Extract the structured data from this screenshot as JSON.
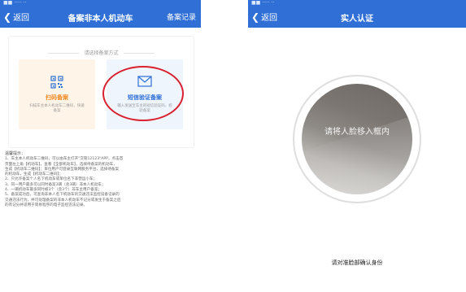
{
  "left": {
    "status": "■■ ····· ··",
    "back_label": "返回",
    "title": "备案非本人机动车",
    "right_action": "备案记录",
    "card_title": "请选择备案方式",
    "option_scan": {
      "label": "扫码备案",
      "desc": "扫描车主本人机动车二维码，快速备案",
      "icon": "qr-code-icon",
      "color": "#f08a24"
    },
    "option_sms": {
      "label": "短信验证备案",
      "desc": "输入发送至车主的短信验证码，校验备案",
      "icon": "envelope-icon",
      "color": "#2f6fd6"
    },
    "notes_title": "温馨提示：",
    "notes": [
      "1、车主本人机动车二维码，可以由车主打开\"交管12123\"APP，点击首",
      "页面左上角【机动车】，查看【全部机动车】，选择待备案的机动车，",
      "生成【机动车二维码】；单位用户可登录互联网服务平台，选择待备案",
      "的机动车，生成【机动车二维码】；",
      "2、只允许备案个人名下机动车或单位名下非营运小车；",
      "3、同一用户最多可以同时备案3辆（含3辆）非本人机动车；",
      "4、一辆机动车最多同时被3个（含3个）非车主用户备案；",
      "5、备案成功后，可查询非本人名下机动车的交通违法监控设备记录的",
      "交通违法行为，并可处理备案的非本人机动车不记分或发生于备案之后",
      "的有记分并适用于简易程序的电子监控违法记录。"
    ]
  },
  "right": {
    "status": "■■ ····· ··",
    "back_label": "返回",
    "title": "实人认证",
    "face_prompt": "请将人脸移入框内",
    "hint": "请对准脸部确认身份"
  },
  "colors": {
    "primary": "#2f6fd6",
    "highlight_ring": "#d92130"
  }
}
